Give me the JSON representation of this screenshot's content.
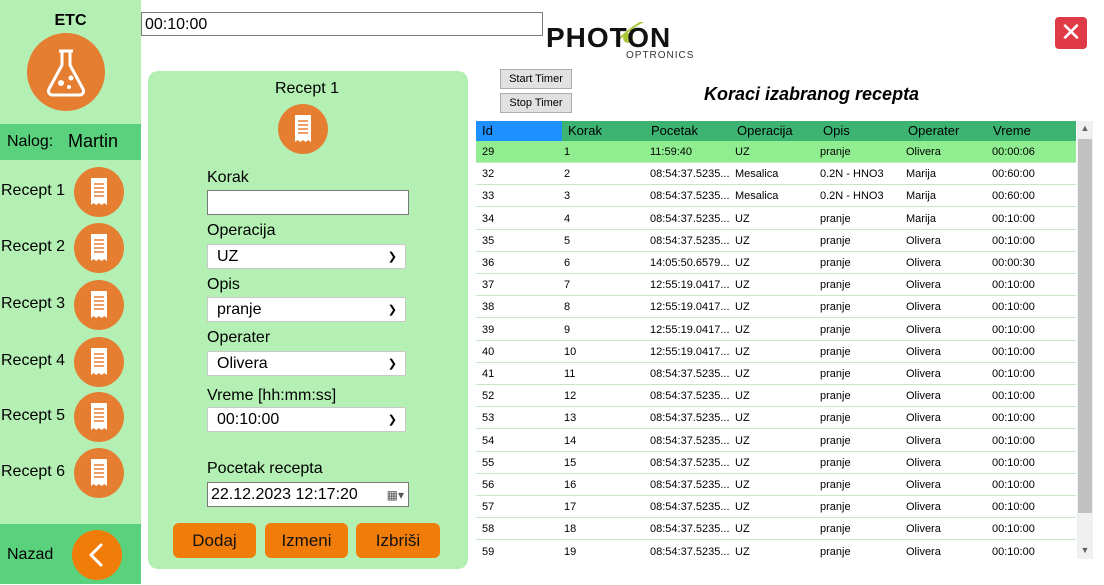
{
  "sidebar": {
    "title": "ETC",
    "nalog_label": "Nalog:",
    "nalog_user": "Martin",
    "items": [
      {
        "label": "Recept 1"
      },
      {
        "label": "Recept 2"
      },
      {
        "label": "Recept 3"
      },
      {
        "label": "Recept 4"
      },
      {
        "label": "Recept 5"
      },
      {
        "label": "Recept 6"
      }
    ],
    "back_label": "Nazad"
  },
  "timer": {
    "value": "00:10:00",
    "start_label": "Start Timer",
    "stop_label": "Stop Timer"
  },
  "logo": {
    "main": "PHOTON",
    "sub": "OPTRONICS"
  },
  "form": {
    "title": "Recept 1",
    "korak_label": "Korak",
    "korak_value": "",
    "operacija_label": "Operacija",
    "operacija_value": "UZ",
    "opis_label": "Opis",
    "opis_value": "pranje",
    "operater_label": "Operater",
    "operater_value": "Olivera",
    "vreme_label": "Vreme [hh:mm:ss]",
    "vreme_value": "00:10:00",
    "pocetak_label": "Pocetak recepta",
    "pocetak_value": "22.12.2023 12:17:20",
    "add_label": "Dodaj",
    "edit_label": "Izmeni",
    "delete_label": "Izbriši"
  },
  "grid": {
    "title": "Koraci izabranog recepta",
    "columns": [
      "Id",
      "Korak",
      "Pocetak",
      "Operacija",
      "Opis",
      "Operater",
      "Vreme"
    ],
    "rows": [
      [
        "29",
        "1",
        "11:59:40",
        "UZ",
        "pranje",
        "Olivera",
        "00:00:06"
      ],
      [
        "32",
        "2",
        "08:54:37.5235...",
        "Mesalica",
        "0.2N - HNO3",
        "Marija",
        "00:60:00"
      ],
      [
        "33",
        "3",
        "08:54:37.5235...",
        "Mesalica",
        "0.2N - HNO3",
        "Marija",
        "00:60:00"
      ],
      [
        "34",
        "4",
        "08:54:37.5235...",
        "UZ",
        "pranje",
        "Marija",
        "00:10:00"
      ],
      [
        "35",
        "5",
        "08:54:37.5235...",
        "UZ",
        "pranje",
        "Olivera",
        "00:10:00"
      ],
      [
        "36",
        "6",
        "14:05:50.6579...",
        "UZ",
        "pranje",
        "Olivera",
        "00:00:30"
      ],
      [
        "37",
        "7",
        "12:55:19.0417...",
        "UZ",
        "pranje",
        "Olivera",
        "00:10:00"
      ],
      [
        "38",
        "8",
        "12:55:19.0417...",
        "UZ",
        "pranje",
        "Olivera",
        "00:10:00"
      ],
      [
        "39",
        "9",
        "12:55:19.0417...",
        "UZ",
        "pranje",
        "Olivera",
        "00:10:00"
      ],
      [
        "40",
        "10",
        "12:55:19.0417...",
        "UZ",
        "pranje",
        "Olivera",
        "00:10:00"
      ],
      [
        "41",
        "11",
        "08:54:37.5235...",
        "UZ",
        "pranje",
        "Olivera",
        "00:10:00"
      ],
      [
        "52",
        "12",
        "08:54:37.5235...",
        "UZ",
        "pranje",
        "Olivera",
        "00:10:00"
      ],
      [
        "53",
        "13",
        "08:54:37.5235...",
        "UZ",
        "pranje",
        "Olivera",
        "00:10:00"
      ],
      [
        "54",
        "14",
        "08:54:37.5235...",
        "UZ",
        "pranje",
        "Olivera",
        "00:10:00"
      ],
      [
        "55",
        "15",
        "08:54:37.5235...",
        "UZ",
        "pranje",
        "Olivera",
        "00:10:00"
      ],
      [
        "56",
        "16",
        "08:54:37.5235...",
        "UZ",
        "pranje",
        "Olivera",
        "00:10:00"
      ],
      [
        "57",
        "17",
        "08:54:37.5235...",
        "UZ",
        "pranje",
        "Olivera",
        "00:10:00"
      ],
      [
        "58",
        "18",
        "08:54:37.5235...",
        "UZ",
        "pranje",
        "Olivera",
        "00:10:00"
      ],
      [
        "59",
        "19",
        "08:54:37.5235...",
        "UZ",
        "pranje",
        "Olivera",
        "00:10:00"
      ]
    ]
  },
  "colors": {
    "sidebar_bg": "#b4f0b4",
    "accent_green": "#5ad27d",
    "header_green": "#3cb371",
    "orange": "#e67e32",
    "close_red": "#e03a46"
  },
  "icons": {
    "etc": "flask-icon",
    "recept": "receipt-icon",
    "back": "chevron-left-icon",
    "close": "close-icon"
  }
}
